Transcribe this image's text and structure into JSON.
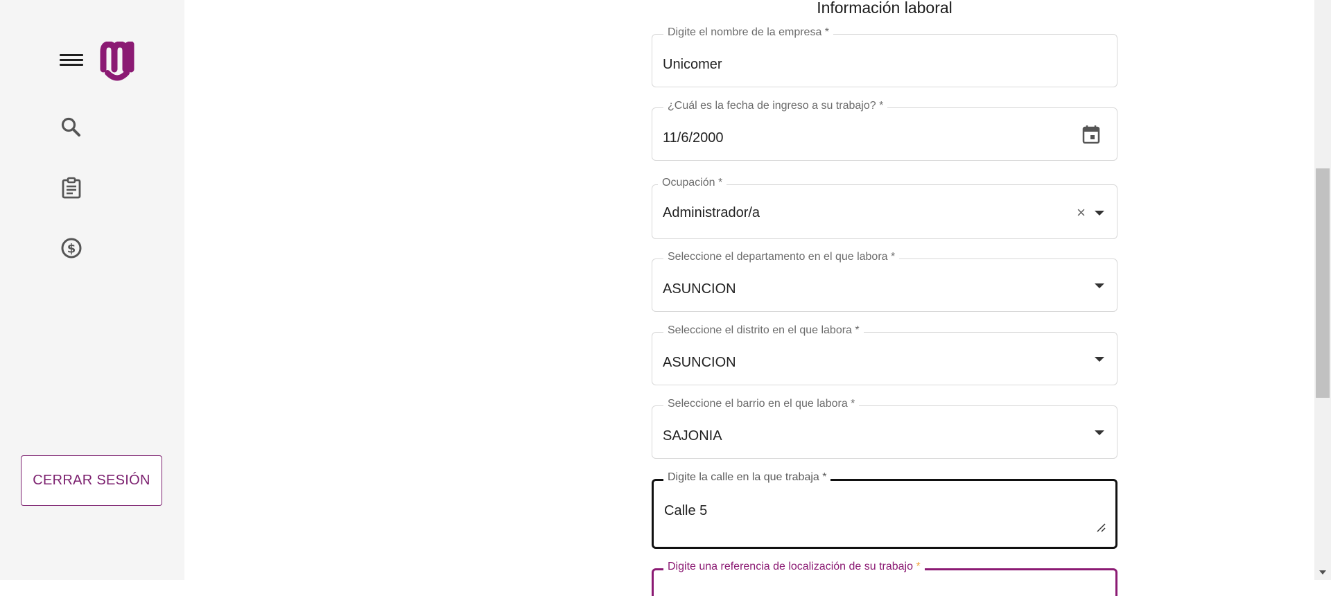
{
  "sidebar": {
    "menu_icon": "hamburger-menu-icon",
    "logo_icon": "brand-logo-icon",
    "nav_icons": [
      "search-icon",
      "clipboard-icon",
      "dollar-circle-icon"
    ],
    "logout_label": "CERRAR SESIÓN"
  },
  "form": {
    "title": "Información laboral",
    "company": {
      "label": "Digite el nombre de la empresa *",
      "value": "Unicomer"
    },
    "start_date": {
      "label": "¿Cuál es la fecha de ingreso a su trabajo? *",
      "value": "11/6/2000"
    },
    "occupation": {
      "label": "Ocupación *",
      "value": "Administrador/a",
      "clear_icon": "×"
    },
    "department": {
      "label": "Seleccione el departamento en el que labora *",
      "value": "ASUNCION"
    },
    "district": {
      "label": "Seleccione el distrito en el que labora *",
      "value": "ASUNCION"
    },
    "neighborhood": {
      "label": "Seleccione el barrio en el que labora *",
      "value": "SAJONIA"
    },
    "street": {
      "label": "Digite la calle en la que trabaja *",
      "value": "Calle 5"
    },
    "reference": {
      "label": "Digite una referencia de localización de su trabajo",
      "required_mark": "*"
    }
  },
  "colors": {
    "brand": "#8b1a73",
    "sidebar_bg": "#f5f5f5",
    "required_accent": "#f2a23a"
  }
}
